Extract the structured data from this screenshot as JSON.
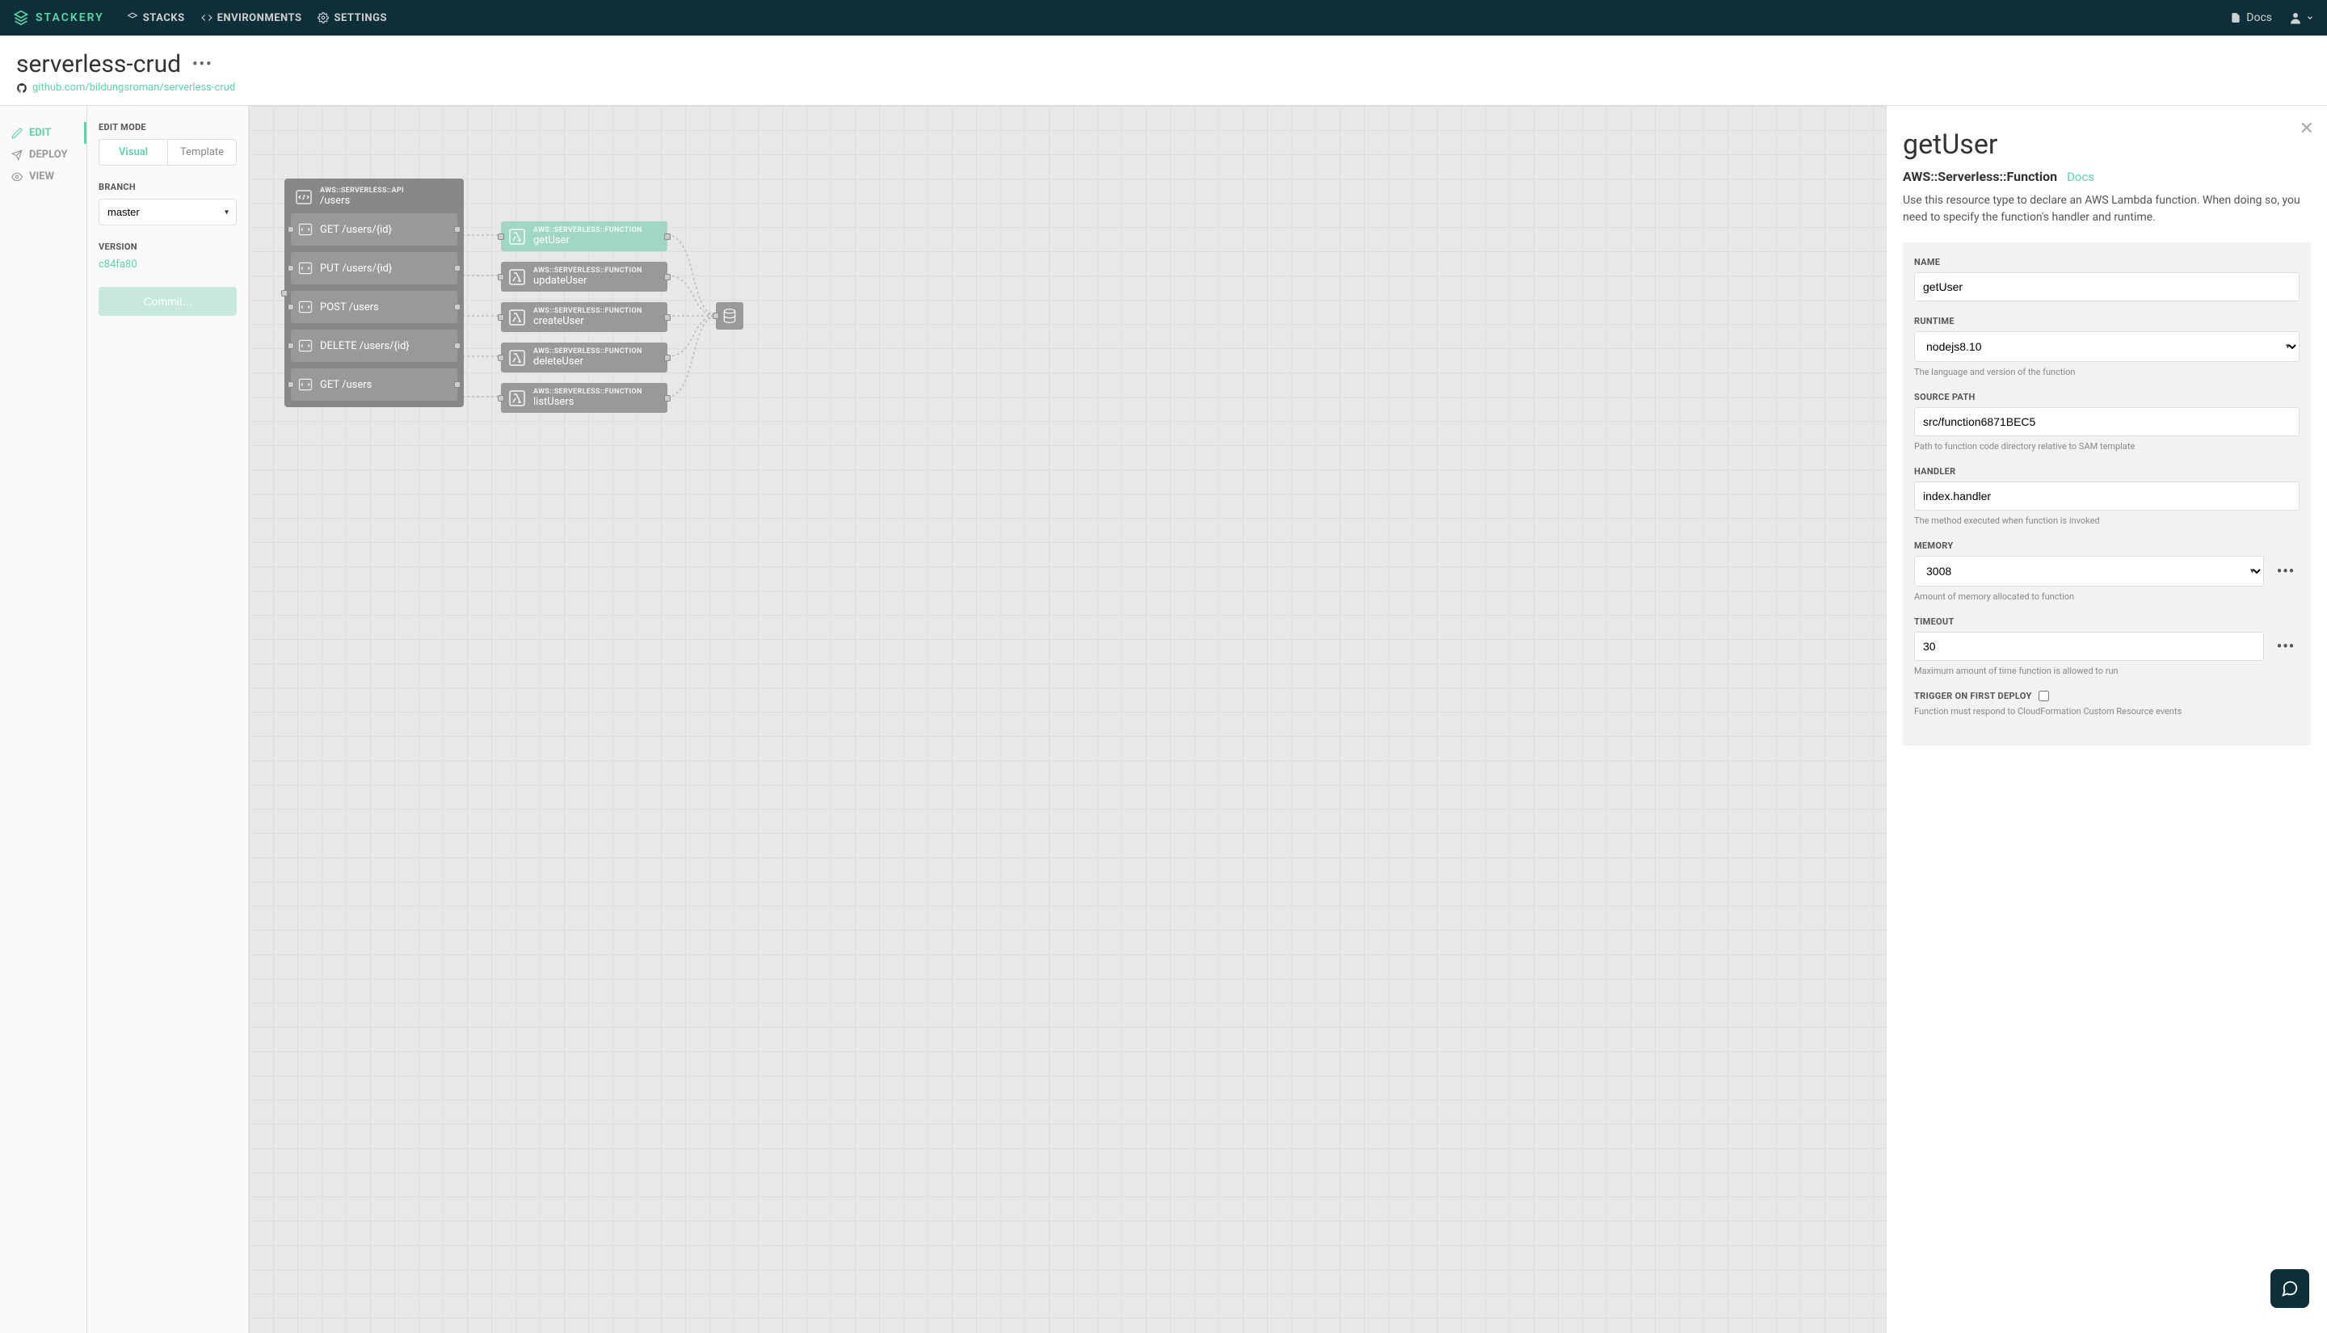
{
  "nav": {
    "brand": "STACKERY",
    "links": {
      "stacks": "STACKS",
      "environments": "ENVIRONMENTS",
      "settings": "SETTINGS"
    },
    "docs": "Docs"
  },
  "header": {
    "stack_name": "serverless-crud",
    "repo_url": "github.com/bildungsroman/serverless-crud"
  },
  "rail": {
    "edit": "EDIT",
    "deploy": "DEPLOY",
    "view": "VIEW"
  },
  "left_panel": {
    "edit_mode_label": "EDIT MODE",
    "mode_visual": "Visual",
    "mode_template": "Template",
    "branch_label": "BRANCH",
    "branch_value": "master",
    "version_label": "VERSION",
    "version_value": "c84fa80",
    "commit_label": "Commit..."
  },
  "canvas": {
    "api": {
      "type": "AWS::SERVERLESS::API",
      "name": "/users",
      "routes": [
        "GET /users/{id}",
        "PUT /users/{id}",
        "POST /users",
        "DELETE /users/{id}",
        "GET /users"
      ]
    },
    "functions": [
      {
        "type": "AWS::SERVERLESS::FUNCTION",
        "name": "getUser",
        "selected": true
      },
      {
        "type": "AWS::SERVERLESS::FUNCTION",
        "name": "updateUser",
        "selected": false
      },
      {
        "type": "AWS::SERVERLESS::FUNCTION",
        "name": "createUser",
        "selected": false
      },
      {
        "type": "AWS::SERVERLESS::FUNCTION",
        "name": "deleteUser",
        "selected": false
      },
      {
        "type": "AWS::SERVERLESS::FUNCTION",
        "name": "listUsers",
        "selected": false
      }
    ]
  },
  "right_panel": {
    "title": "getUser",
    "subtitle": "AWS::Serverless::Function",
    "docs_link": "Docs",
    "description": "Use this resource type to declare an AWS Lambda function. When doing so, you need to specify the function's handler and runtime.",
    "fields": {
      "name": {
        "label": "NAME",
        "value": "getUser"
      },
      "runtime": {
        "label": "RUNTIME",
        "value": "nodejs8.10",
        "help": "The language and version of the function"
      },
      "source_path": {
        "label": "SOURCE PATH",
        "value": "src/function6871BEC5",
        "help": "Path to function code directory relative to SAM template"
      },
      "handler": {
        "label": "HANDLER",
        "value": "index.handler",
        "help": "The method executed when function is invoked"
      },
      "memory": {
        "label": "MEMORY",
        "value": "3008",
        "help": "Amount of memory allocated to function"
      },
      "timeout": {
        "label": "TIMEOUT",
        "value": "30",
        "help": "Maximum amount of time function is allowed to run"
      },
      "trigger": {
        "label": "TRIGGER ON FIRST DEPLOY",
        "help": "Function must respond to CloudFormation Custom Resource events"
      }
    }
  }
}
